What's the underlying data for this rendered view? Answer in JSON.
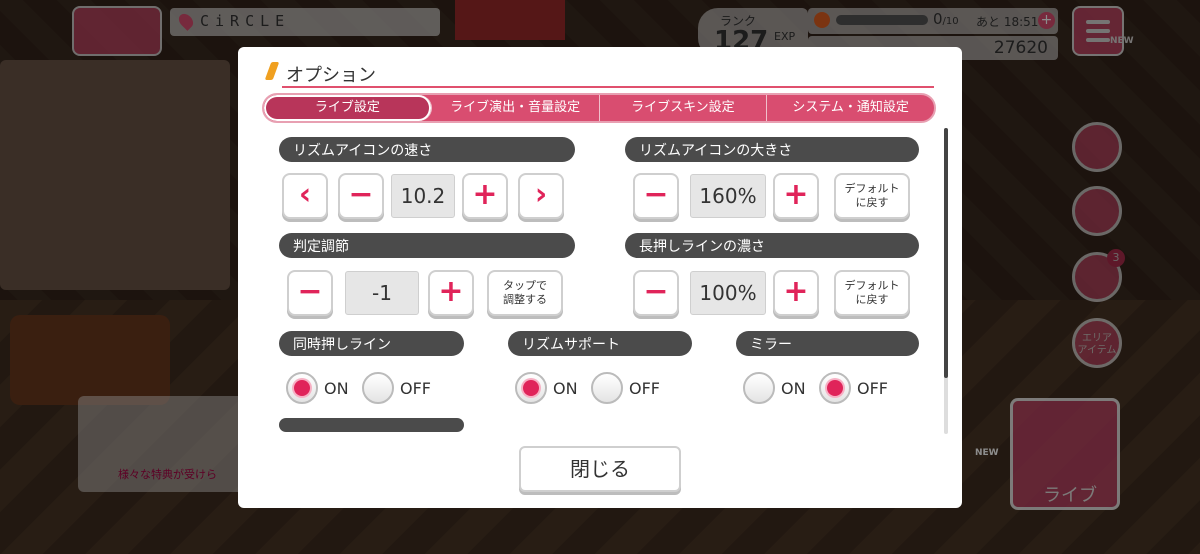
{
  "hud": {
    "location": "CiRCLE",
    "rank_label": "ランク",
    "rank_value": "127",
    "exp_label": "EXP",
    "stamina_value": "0",
    "stamina_max": "/10",
    "recovery_prefix": "あと",
    "recovery_time": "18:51",
    "coins": "27620",
    "menu_new": "NEW",
    "area_item_label": "エリア\nアイテム",
    "gift_badge": "3",
    "live_label": "ライブ",
    "band_banner_text": "様々な特典が受けら",
    "new_badge": "NEW"
  },
  "dialog": {
    "title": "オプション",
    "tabs": [
      "ライブ設定",
      "ライブ演出・音量設定",
      "ライブスキン設定",
      "システム・通知設定"
    ],
    "active_tab": 0,
    "rhythm_speed": {
      "label": "リズムアイコンの速さ",
      "prev": "‹",
      "minus": "−",
      "value": "10.2",
      "plus": "+",
      "next": "›"
    },
    "rhythm_size": {
      "label": "リズムアイコンの大きさ",
      "minus": "−",
      "value": "160%",
      "plus": "+",
      "default": "デフォルト\nに戻す"
    },
    "judge_adjust": {
      "label": "判定調節",
      "minus": "−",
      "value": "-1",
      "plus": "+",
      "tap_adjust": "タップで\n調整する"
    },
    "long_press": {
      "label": "長押しラインの濃さ",
      "minus": "−",
      "value": "100%",
      "plus": "+",
      "default": "デフォルト\nに戻す"
    },
    "simultaneous": {
      "label": "同時押しライン",
      "on": "ON",
      "off": "OFF",
      "state": "on"
    },
    "rhythm_support": {
      "label": "リズムサポート",
      "on": "ON",
      "off": "OFF",
      "state": "on"
    },
    "mirror": {
      "label": "ミラー",
      "on": "ON",
      "off": "OFF",
      "state": "off"
    },
    "close": "閉じる"
  },
  "colors": {
    "accent": "#d94d70",
    "active_tab": "#b8355a",
    "label_bg": "#4b4b4b"
  }
}
